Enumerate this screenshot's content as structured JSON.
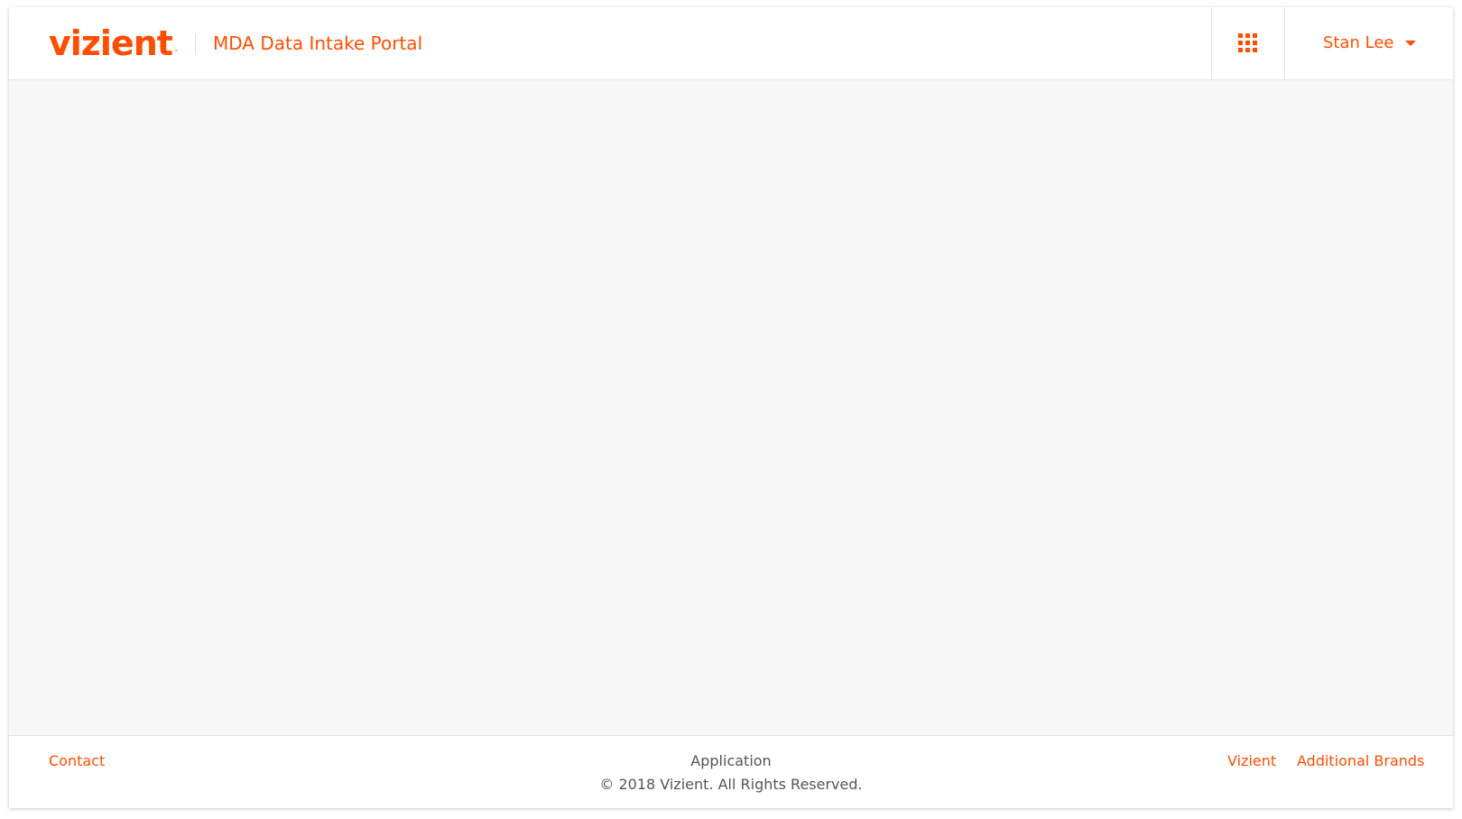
{
  "header": {
    "logo_text": "vizient",
    "logo_tm": "™",
    "app_title": "MDA Data Intake Portal",
    "apps_icon": "grid-9-dots",
    "user_name": "Stan Lee",
    "user_caret_icon": "caret-down"
  },
  "footer": {
    "contact_label": "Contact",
    "center_line1": "Application",
    "center_line2": "© 2018 Vizient. All Rights Reserved.",
    "links": [
      {
        "label": "Vizient"
      },
      {
        "label": "Additional Brands"
      }
    ]
  },
  "colors": {
    "accent": "#ff4e00",
    "background": "#f7f7f7",
    "surface": "#ffffff",
    "muted_text": "#555555",
    "border": "#e5e5e5"
  }
}
